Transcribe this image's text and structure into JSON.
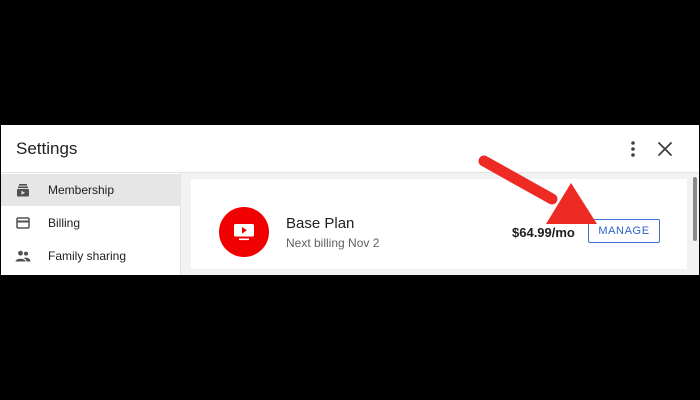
{
  "header": {
    "title": "Settings",
    "more_icon": "more-vert-icon",
    "close_icon": "close-icon"
  },
  "sidebar": {
    "items": [
      {
        "label": "Membership",
        "icon": "membership-icon",
        "active": true
      },
      {
        "label": "Billing",
        "icon": "credit-card-icon",
        "active": false
      },
      {
        "label": "Family sharing",
        "icon": "people-icon",
        "active": false
      }
    ]
  },
  "plan": {
    "name": "Base Plan",
    "next_billing": "Next billing Nov 2",
    "price": "$64.99/mo",
    "manage_label": "MANAGE",
    "logo_icon": "tv-play-icon"
  },
  "colors": {
    "brand_red": "#f00000",
    "arrow_red": "#ee2a24",
    "link_blue": "#2f62c8",
    "active_bg": "#e6e6e6"
  }
}
